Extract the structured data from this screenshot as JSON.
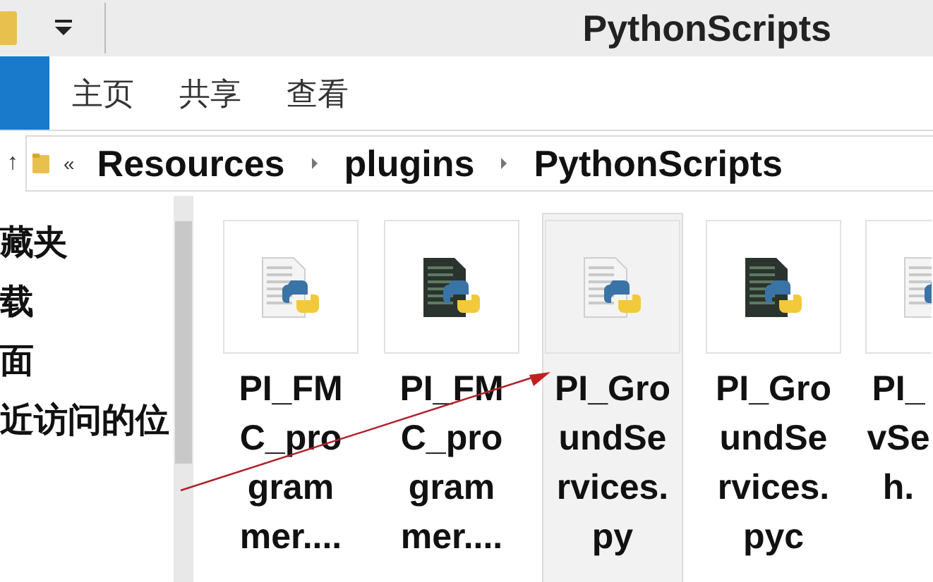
{
  "window": {
    "title": "PythonScripts"
  },
  "ribbon_tabs": [
    {
      "label": "主页",
      "selected": false
    },
    {
      "label": "共享",
      "selected": false
    },
    {
      "label": "查看",
      "selected": false
    }
  ],
  "address_bar": {
    "up": "↑",
    "overflow": "«",
    "crumbs": [
      "Resources",
      "plugins",
      "PythonScripts"
    ]
  },
  "sidebar": {
    "items": [
      "藏夹",
      "载",
      "面",
      "近访问的位"
    ]
  },
  "files": [
    {
      "kind": "py",
      "name_lines": [
        "PI_FM",
        "C_pro",
        "gram",
        "mer...."
      ],
      "selected": false
    },
    {
      "kind": "pyc",
      "name_lines": [
        "PI_FM",
        "C_pro",
        "gram",
        "mer...."
      ],
      "selected": false
    },
    {
      "kind": "py",
      "name_lines": [
        "PI_Gro",
        "undSe",
        "rvices.",
        "py"
      ],
      "selected": true
    },
    {
      "kind": "pyc",
      "name_lines": [
        "PI_Gro",
        "undSe",
        "rvices.",
        "pyc"
      ],
      "selected": false
    },
    {
      "kind": "py",
      "name_lines": [
        "PI_",
        "vSe",
        "h."
      ],
      "selected": false
    }
  ]
}
